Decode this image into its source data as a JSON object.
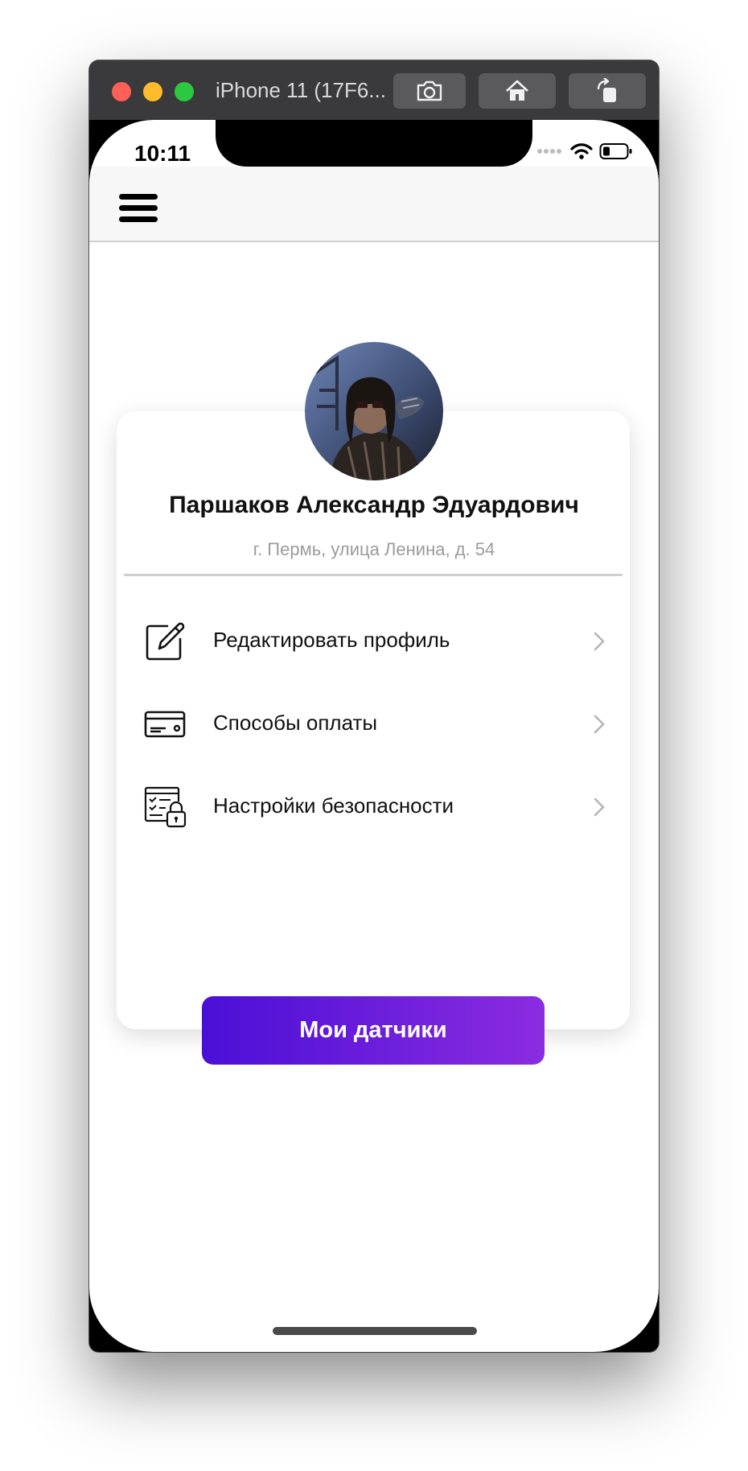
{
  "window": {
    "title": "iPhone 11 (17F6..."
  },
  "status_bar": {
    "time": "10:11"
  },
  "profile": {
    "name": "Паршаков Александр Эдуардович",
    "address": "г. Пермь, улица Ленина, д. 54"
  },
  "menu": {
    "items": [
      {
        "label": "Редактировать профиль",
        "icon": "edit-icon"
      },
      {
        "label": "Способы оплаты",
        "icon": "credit-card-icon"
      },
      {
        "label": "Настройки безопасности",
        "icon": "security-settings-icon"
      }
    ]
  },
  "actions": {
    "primary_label": "Мои датчики"
  },
  "colors": {
    "accent_start": "#4a0fd6",
    "accent_end": "#8b2ce0",
    "titlebar": "#3a3a3c"
  }
}
